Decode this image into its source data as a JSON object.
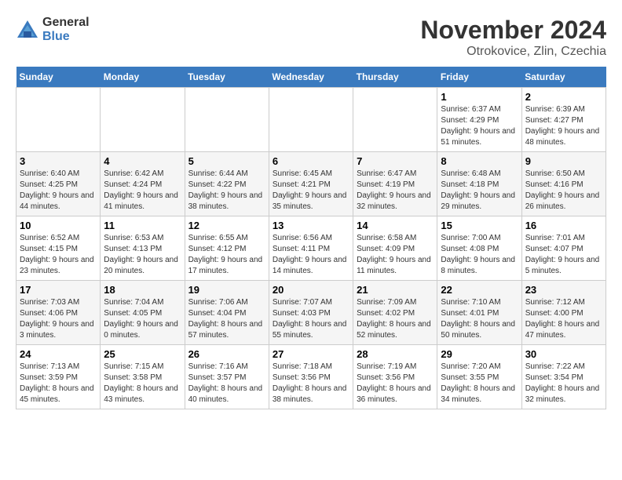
{
  "logo": {
    "general": "General",
    "blue": "Blue"
  },
  "title": "November 2024",
  "subtitle": "Otrokovice, Zlin, Czechia",
  "headers": [
    "Sunday",
    "Monday",
    "Tuesday",
    "Wednesday",
    "Thursday",
    "Friday",
    "Saturday"
  ],
  "weeks": [
    [
      {
        "day": "",
        "info": ""
      },
      {
        "day": "",
        "info": ""
      },
      {
        "day": "",
        "info": ""
      },
      {
        "day": "",
        "info": ""
      },
      {
        "day": "",
        "info": ""
      },
      {
        "day": "1",
        "info": "Sunrise: 6:37 AM\nSunset: 4:29 PM\nDaylight: 9 hours and 51 minutes."
      },
      {
        "day": "2",
        "info": "Sunrise: 6:39 AM\nSunset: 4:27 PM\nDaylight: 9 hours and 48 minutes."
      }
    ],
    [
      {
        "day": "3",
        "info": "Sunrise: 6:40 AM\nSunset: 4:25 PM\nDaylight: 9 hours and 44 minutes."
      },
      {
        "day": "4",
        "info": "Sunrise: 6:42 AM\nSunset: 4:24 PM\nDaylight: 9 hours and 41 minutes."
      },
      {
        "day": "5",
        "info": "Sunrise: 6:44 AM\nSunset: 4:22 PM\nDaylight: 9 hours and 38 minutes."
      },
      {
        "day": "6",
        "info": "Sunrise: 6:45 AM\nSunset: 4:21 PM\nDaylight: 9 hours and 35 minutes."
      },
      {
        "day": "7",
        "info": "Sunrise: 6:47 AM\nSunset: 4:19 PM\nDaylight: 9 hours and 32 minutes."
      },
      {
        "day": "8",
        "info": "Sunrise: 6:48 AM\nSunset: 4:18 PM\nDaylight: 9 hours and 29 minutes."
      },
      {
        "day": "9",
        "info": "Sunrise: 6:50 AM\nSunset: 4:16 PM\nDaylight: 9 hours and 26 minutes."
      }
    ],
    [
      {
        "day": "10",
        "info": "Sunrise: 6:52 AM\nSunset: 4:15 PM\nDaylight: 9 hours and 23 minutes."
      },
      {
        "day": "11",
        "info": "Sunrise: 6:53 AM\nSunset: 4:13 PM\nDaylight: 9 hours and 20 minutes."
      },
      {
        "day": "12",
        "info": "Sunrise: 6:55 AM\nSunset: 4:12 PM\nDaylight: 9 hours and 17 minutes."
      },
      {
        "day": "13",
        "info": "Sunrise: 6:56 AM\nSunset: 4:11 PM\nDaylight: 9 hours and 14 minutes."
      },
      {
        "day": "14",
        "info": "Sunrise: 6:58 AM\nSunset: 4:09 PM\nDaylight: 9 hours and 11 minutes."
      },
      {
        "day": "15",
        "info": "Sunrise: 7:00 AM\nSunset: 4:08 PM\nDaylight: 9 hours and 8 minutes."
      },
      {
        "day": "16",
        "info": "Sunrise: 7:01 AM\nSunset: 4:07 PM\nDaylight: 9 hours and 5 minutes."
      }
    ],
    [
      {
        "day": "17",
        "info": "Sunrise: 7:03 AM\nSunset: 4:06 PM\nDaylight: 9 hours and 3 minutes."
      },
      {
        "day": "18",
        "info": "Sunrise: 7:04 AM\nSunset: 4:05 PM\nDaylight: 9 hours and 0 minutes."
      },
      {
        "day": "19",
        "info": "Sunrise: 7:06 AM\nSunset: 4:04 PM\nDaylight: 8 hours and 57 minutes."
      },
      {
        "day": "20",
        "info": "Sunrise: 7:07 AM\nSunset: 4:03 PM\nDaylight: 8 hours and 55 minutes."
      },
      {
        "day": "21",
        "info": "Sunrise: 7:09 AM\nSunset: 4:02 PM\nDaylight: 8 hours and 52 minutes."
      },
      {
        "day": "22",
        "info": "Sunrise: 7:10 AM\nSunset: 4:01 PM\nDaylight: 8 hours and 50 minutes."
      },
      {
        "day": "23",
        "info": "Sunrise: 7:12 AM\nSunset: 4:00 PM\nDaylight: 8 hours and 47 minutes."
      }
    ],
    [
      {
        "day": "24",
        "info": "Sunrise: 7:13 AM\nSunset: 3:59 PM\nDaylight: 8 hours and 45 minutes."
      },
      {
        "day": "25",
        "info": "Sunrise: 7:15 AM\nSunset: 3:58 PM\nDaylight: 8 hours and 43 minutes."
      },
      {
        "day": "26",
        "info": "Sunrise: 7:16 AM\nSunset: 3:57 PM\nDaylight: 8 hours and 40 minutes."
      },
      {
        "day": "27",
        "info": "Sunrise: 7:18 AM\nSunset: 3:56 PM\nDaylight: 8 hours and 38 minutes."
      },
      {
        "day": "28",
        "info": "Sunrise: 7:19 AM\nSunset: 3:56 PM\nDaylight: 8 hours and 36 minutes."
      },
      {
        "day": "29",
        "info": "Sunrise: 7:20 AM\nSunset: 3:55 PM\nDaylight: 8 hours and 34 minutes."
      },
      {
        "day": "30",
        "info": "Sunrise: 7:22 AM\nSunset: 3:54 PM\nDaylight: 8 hours and 32 minutes."
      }
    ]
  ]
}
